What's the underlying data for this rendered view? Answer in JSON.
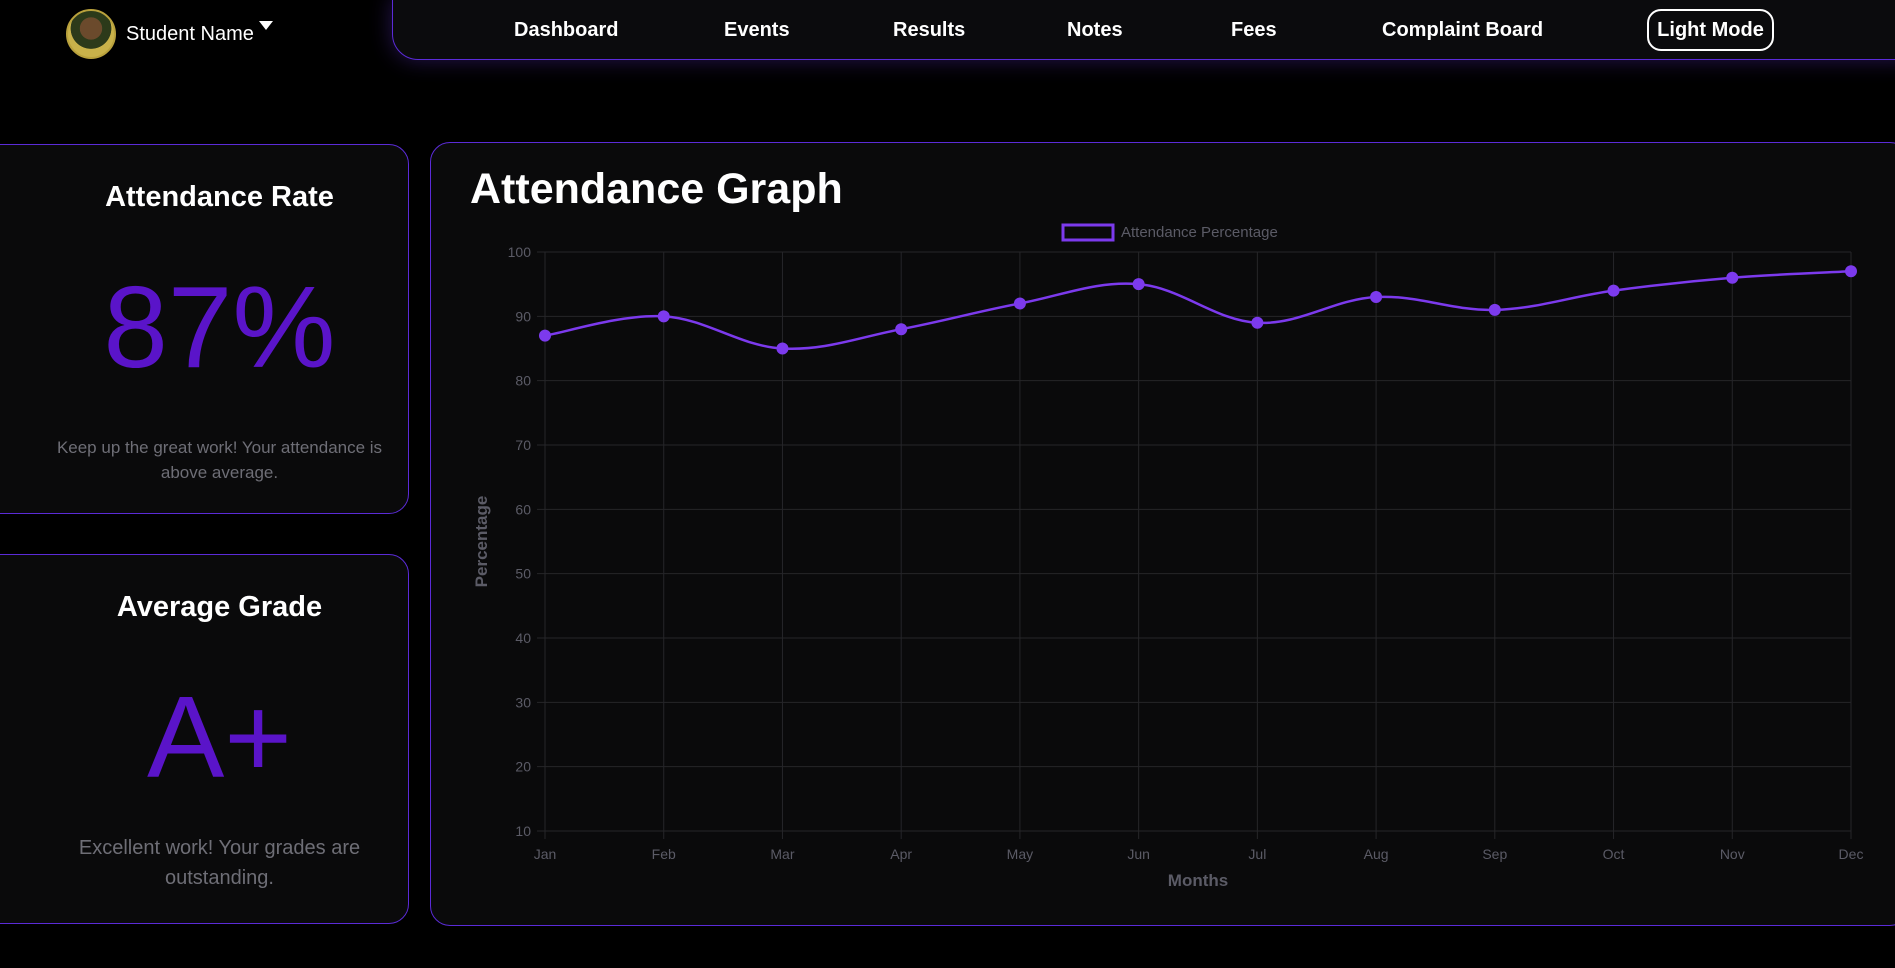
{
  "header": {
    "student_name": "Student Name",
    "nav": [
      "Dashboard",
      "Events",
      "Results",
      "Notes",
      "Fees",
      "Complaint Board"
    ],
    "mode_button": "Light Mode"
  },
  "attendance_card": {
    "title": "Attendance Rate",
    "value": "87%",
    "note": "Keep up the great work! Your attendance is above average."
  },
  "grade_card": {
    "title": "Average Grade",
    "value": "A+",
    "note": "Excellent work! Your grades are outstanding."
  },
  "graph_card": {
    "title": "Attendance Graph"
  },
  "colors": {
    "accent": "#5a14c9",
    "line": "#7c3aed",
    "border": "#5b2bd8",
    "axis_text": "#5b5b66"
  },
  "chart_data": {
    "type": "line",
    "categories": [
      "Jan",
      "Feb",
      "Mar",
      "Apr",
      "May",
      "Jun",
      "Jul",
      "Aug",
      "Sep",
      "Oct",
      "Nov",
      "Dec"
    ],
    "series": [
      {
        "name": "Attendance Percentage",
        "values": [
          87,
          90,
          85,
          88,
          92,
          95,
          89,
          93,
          91,
          94,
          96,
          97
        ]
      }
    ],
    "y_ticks": [
      10,
      20,
      30,
      40,
      50,
      60,
      70,
      80,
      90,
      100
    ],
    "xlabel": "Months",
    "ylabel": "Percentage",
    "ylim": [
      10,
      100
    ],
    "grid": true,
    "legend_position": "top"
  }
}
